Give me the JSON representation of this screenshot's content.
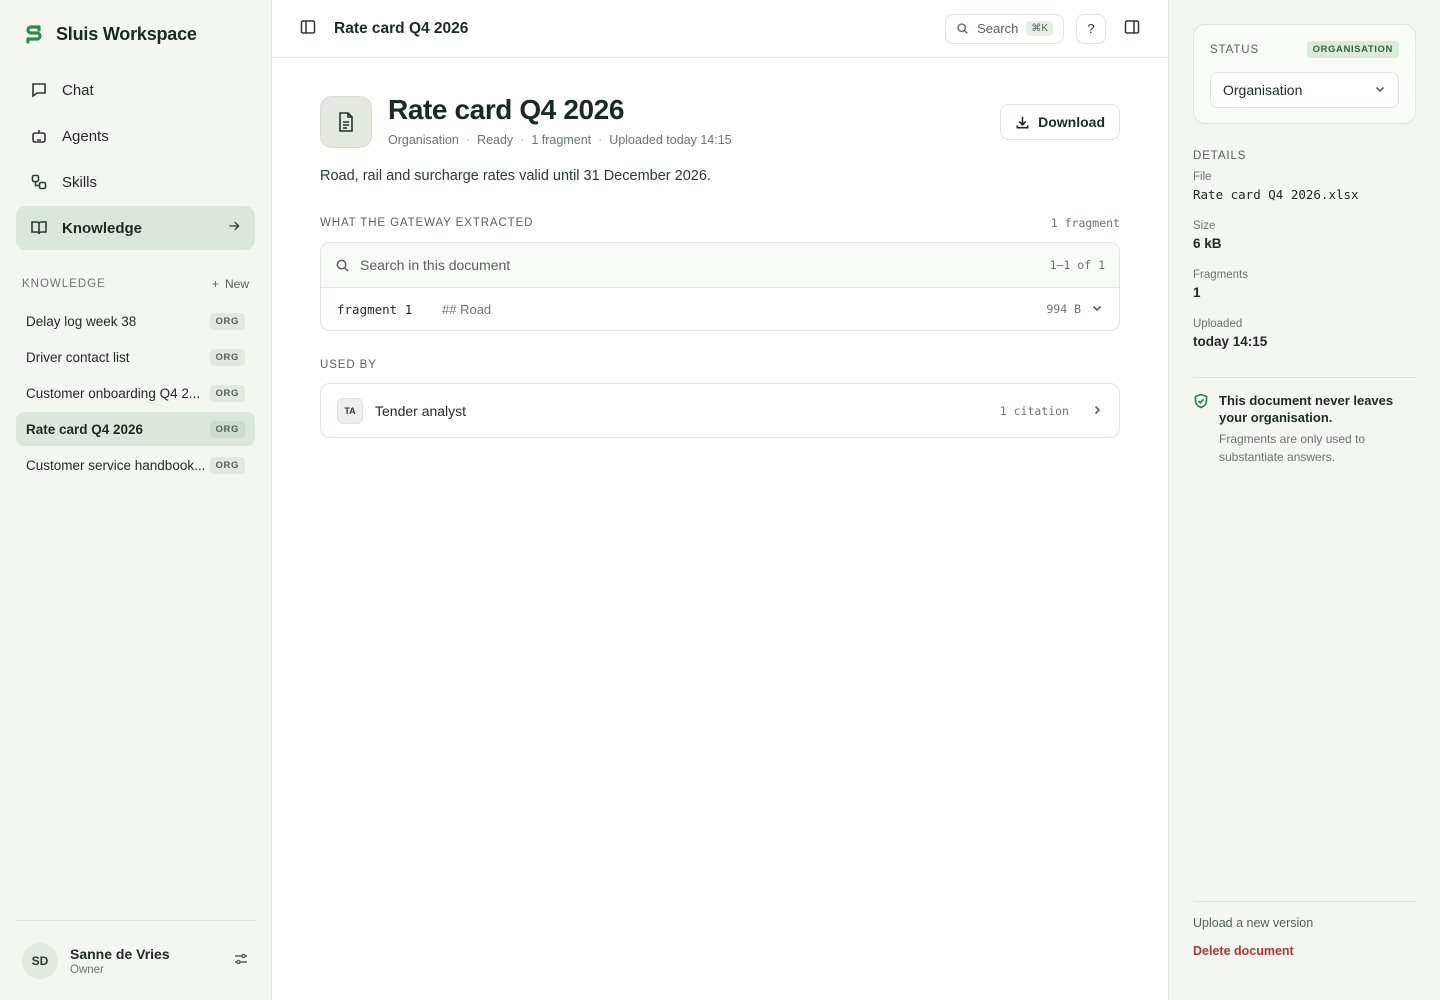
{
  "brand": {
    "name": "Sluis Workspace"
  },
  "nav": [
    {
      "label": "Chat",
      "icon": "chat-icon"
    },
    {
      "label": "Agents",
      "icon": "robot-icon"
    },
    {
      "label": "Skills",
      "icon": "skills-icon"
    },
    {
      "label": "Knowledge",
      "icon": "book-icon",
      "active": true
    }
  ],
  "knowledge_section": {
    "label": "KNOWLEDGE",
    "new_label": "New",
    "documents": [
      {
        "title": "Delay log week 38",
        "badge": "ORG"
      },
      {
        "title": "Driver contact list",
        "badge": "ORG"
      },
      {
        "title": "Customer onboarding Q4 2...",
        "badge": "ORG"
      },
      {
        "title": "Rate card Q4 2026",
        "badge": "ORG",
        "active": true
      },
      {
        "title": "Customer service handbook...",
        "badge": "ORG"
      }
    ]
  },
  "user": {
    "initials": "SD",
    "name": "Sanne de Vries",
    "role": "Owner"
  },
  "topbar": {
    "title": "Rate card Q4 2026",
    "search_label": "Search",
    "search_shortcut": "⌘K",
    "help_label": "?"
  },
  "document": {
    "title": "Rate card Q4 2026",
    "meta": [
      "Organisation",
      "Ready",
      "1 fragment",
      "Uploaded today 14:15"
    ],
    "download_label": "Download",
    "description": "Road, rail and surcharge rates valid until 31 December 2026."
  },
  "extracted": {
    "label": "WHAT THE GATEWAY EXTRACTED",
    "count": "1 fragment",
    "search_placeholder": "Search in this document",
    "range": "1–1 of 1",
    "fragments": [
      {
        "name": "fragment 1",
        "preview": "## Road",
        "size": "994 B"
      }
    ]
  },
  "used_by": {
    "label": "USED BY",
    "items": [
      {
        "initials": "TA",
        "name": "Tender analyst",
        "citations": "1 citation"
      }
    ]
  },
  "status_panel": {
    "label": "STATUS",
    "badge": "ORGANISATION",
    "selected": "Organisation"
  },
  "details": {
    "label": "DETAILS",
    "file_key": "File",
    "file_val": "Rate card Q4 2026.xlsx",
    "size_key": "Size",
    "size_val": "6 kB",
    "fragments_key": "Fragments",
    "fragments_val": "1",
    "uploaded_key": "Uploaded",
    "uploaded_val": "today 14:15"
  },
  "security": {
    "title": "This document never leaves your organisation.",
    "text": "Fragments are only used to substantiate answers."
  },
  "actions": {
    "upload": "Upload a new version",
    "delete": "Delete document"
  },
  "colors": {
    "accent": "#2e7a4a",
    "danger": "#b3372e",
    "sidebar_bg": "#f3f6f1"
  }
}
